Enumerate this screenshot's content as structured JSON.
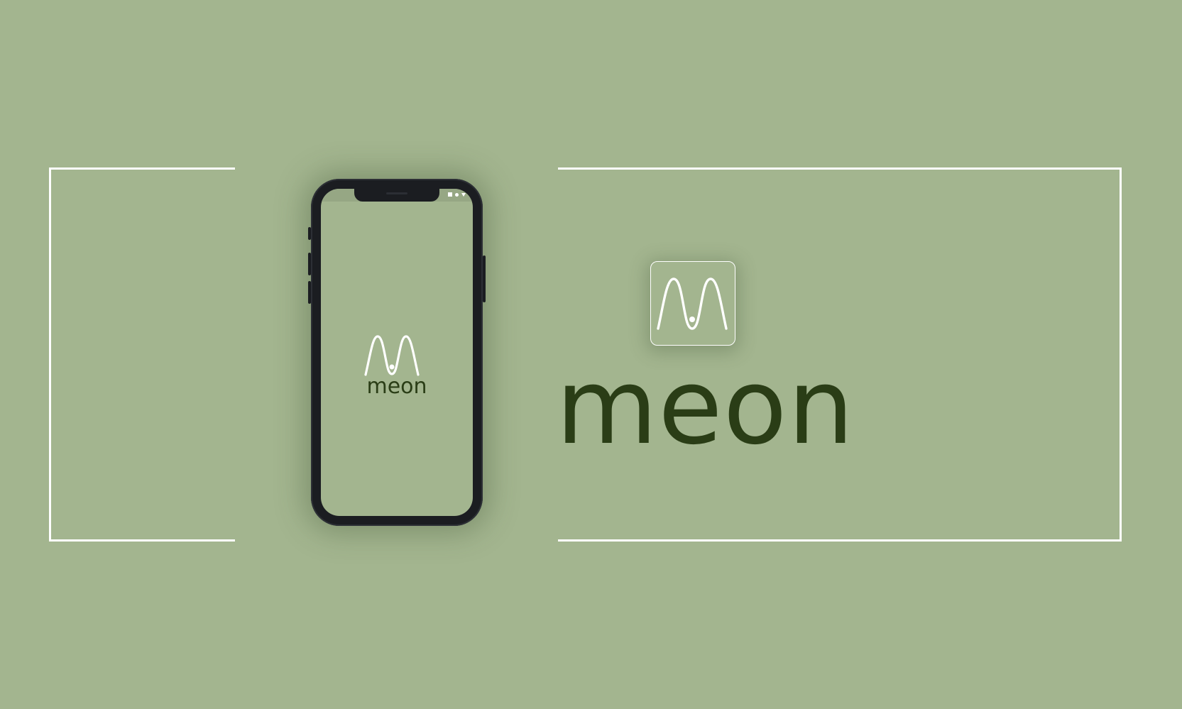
{
  "brand": {
    "name": "meon",
    "wordmark_color": "#2a3d16",
    "background_color": "#a3b58f",
    "logo_icon": "double-wave-with-dot-icon"
  },
  "phone": {
    "screen_wordmark": "meon",
    "status_icons": [
      "battery-icon",
      "signal-dot-icon",
      "wifi-icon"
    ]
  },
  "main": {
    "wordmark": "meon"
  }
}
